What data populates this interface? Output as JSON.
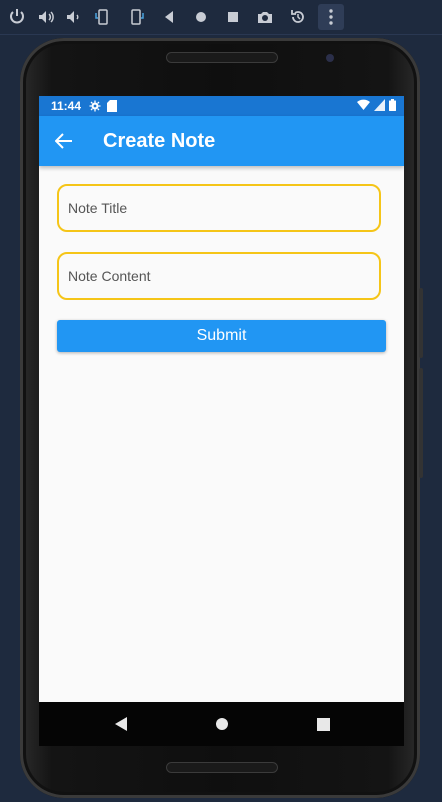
{
  "emulator_toolbar": {
    "icons": [
      "power-icon",
      "volume-up-icon",
      "volume-down-icon",
      "rotate-left-icon",
      "rotate-right-icon",
      "back-icon",
      "home-icon",
      "overview-icon",
      "camera-icon",
      "replay-icon",
      "more-icon"
    ]
  },
  "status_bar": {
    "time": "11:44",
    "icons": [
      "settings-icon",
      "sd-card-icon",
      "wifi-icon",
      "signal-icon",
      "battery-icon"
    ],
    "color": "#1976d2"
  },
  "app_bar": {
    "title": "Create Note",
    "back_icon": "arrow-back-icon",
    "color": "#2196f3"
  },
  "form": {
    "title_placeholder": "Note Title",
    "title_value": "",
    "content_placeholder": "Note Content",
    "content_value": "",
    "submit_label": "Submit",
    "field_border_color": "#f5c518"
  },
  "nav_bar": {
    "icons": [
      "nav-back-icon",
      "nav-home-icon",
      "nav-recents-icon"
    ]
  }
}
